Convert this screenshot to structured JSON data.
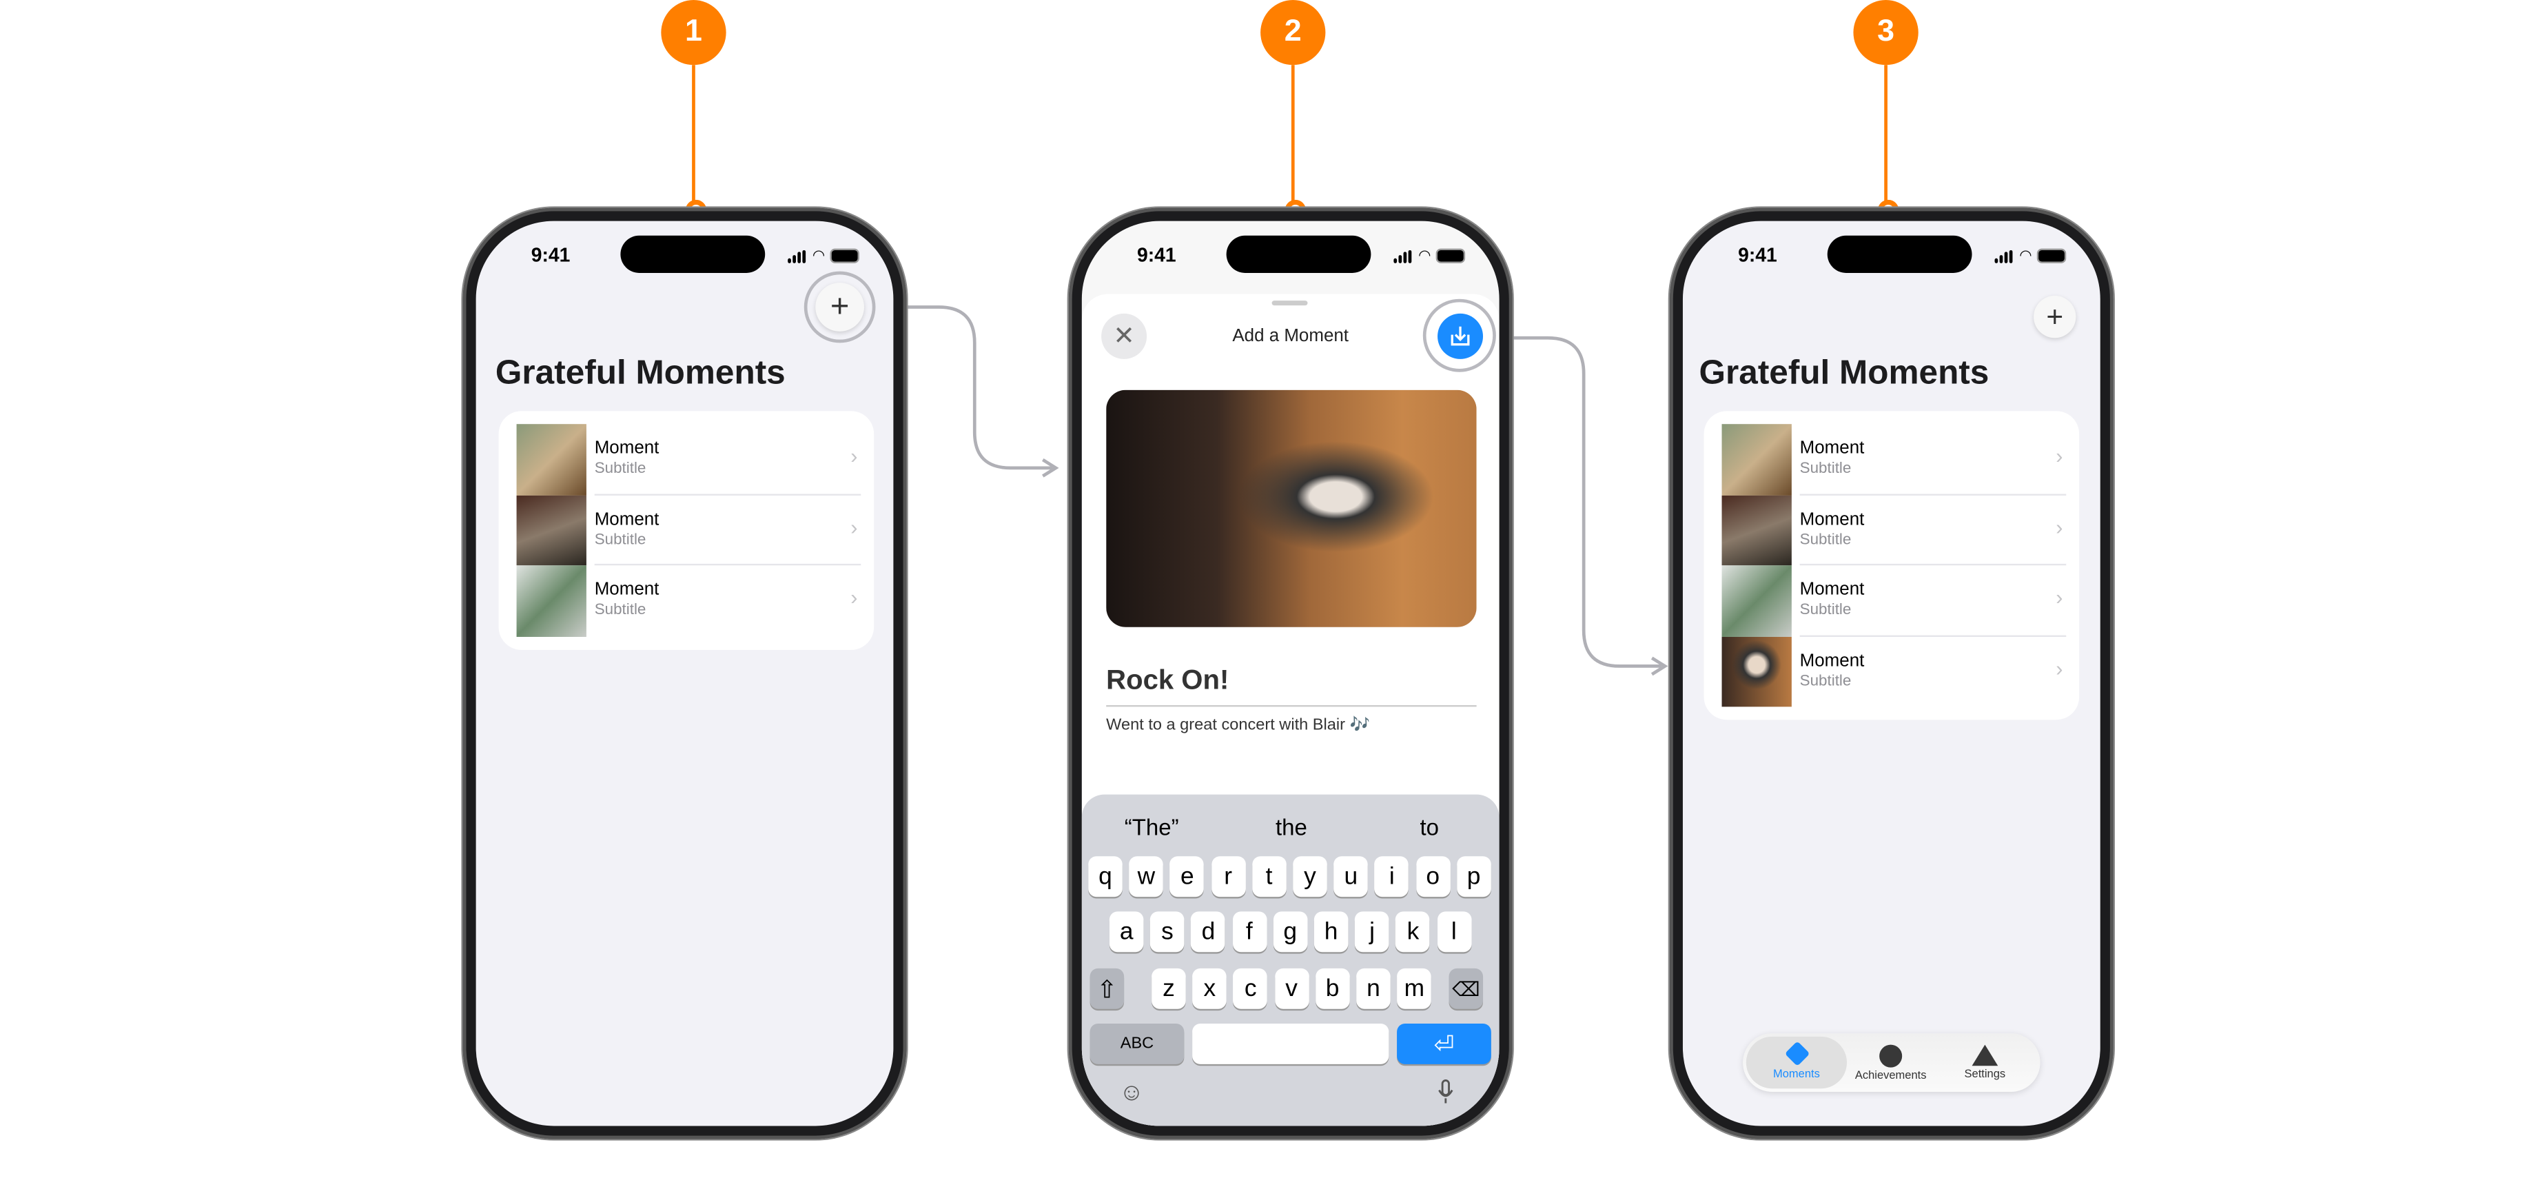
{
  "steps": [
    "1",
    "2",
    "3"
  ],
  "colors": {
    "accent": "#ff7f00",
    "blue": "#1a8cff",
    "background": "#f2f2f7"
  },
  "status": {
    "time": "9:41"
  },
  "list_screen": {
    "title": "Grateful Moments",
    "add_icon": "plus-icon",
    "items": [
      {
        "title": "Moment",
        "subtitle": "Subtitle"
      },
      {
        "title": "Moment",
        "subtitle": "Subtitle"
      },
      {
        "title": "Moment",
        "subtitle": "Subtitle"
      },
      {
        "title": "Moment",
        "subtitle": "Subtitle"
      }
    ]
  },
  "add_screen": {
    "title": "Add a Moment",
    "close_icon": "xmark-icon",
    "save_icon": "tray-arrow-down-icon",
    "moment_title": "Rock On!",
    "moment_body": "Went to a great concert with Blair 🎶",
    "keyboard": {
      "suggestions": [
        "“The”",
        "the",
        "to"
      ],
      "row1": [
        "q",
        "w",
        "e",
        "r",
        "t",
        "y",
        "u",
        "i",
        "o",
        "p"
      ],
      "row2": [
        "a",
        "s",
        "d",
        "f",
        "g",
        "h",
        "j",
        "k",
        "l"
      ],
      "row3": [
        "z",
        "x",
        "c",
        "v",
        "b",
        "n",
        "m"
      ],
      "abc_label": "ABC"
    }
  },
  "tab_bar": {
    "tabs": [
      {
        "label": "Moments",
        "icon": "diamond-icon",
        "selected": true
      },
      {
        "label": "Achievements",
        "icon": "circle-icon",
        "selected": false
      },
      {
        "label": "Settings",
        "icon": "triangle-icon",
        "selected": false
      }
    ]
  }
}
